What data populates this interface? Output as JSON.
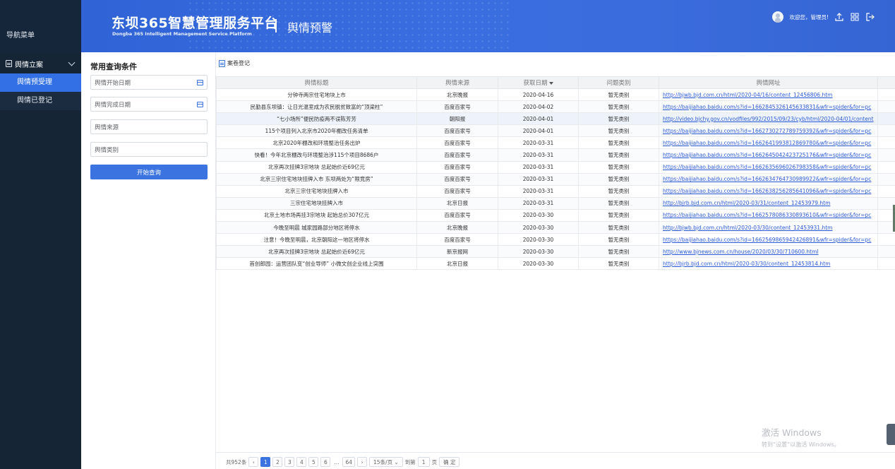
{
  "sidebar": {
    "nav_title": "导航菜单",
    "group_label": "舆情立案",
    "items": [
      {
        "label": "舆情预受理"
      },
      {
        "label": "舆情已登记"
      }
    ]
  },
  "header": {
    "brand_title": "东坝365智慧管理服务平台",
    "brand_subtitle": "Dongba 365 Intelligent Management Service Platform",
    "page_title": "舆情预警",
    "welcome": "欢迎您，管理员!"
  },
  "query": {
    "title": "常用查询条件",
    "start_date_placeholder": "舆情开始日期",
    "end_date_placeholder": "舆情完成日期",
    "source_placeholder": "舆情来源",
    "category_placeholder": "舆情类别",
    "search_button": "开始查询"
  },
  "toolbar": {
    "register_label": "案卷登记"
  },
  "table": {
    "columns": [
      "舆情标题",
      "舆情来源",
      "获取日期",
      "问题类别",
      "舆情网址"
    ],
    "rows": [
      [
        "分钟寺两宗住宅地块上市",
        "北京晚报",
        "2020-04-16",
        "暂无类别",
        "http://bjwb.bjd.com.cn/html/2020-04/16/content_12456806.htm"
      ],
      [
        "民勤县东坝镇：让日光温室成为农民脱贫致富的“顶梁柱”",
        "百度百家号",
        "2020-04-02",
        "暂无类别",
        "https://baijiahao.baidu.com/s?id=1662845326145633831&wfr=spider&for=pc"
      ],
      [
        "“七小场所”便民防疫两不误陈芳芳",
        "朝阳报",
        "2020-04-01",
        "暂无类别",
        "http://video.bjchy.gov.cn/vodfiles/992/2015/09/23/cyb/html/2020-04/01/content"
      ],
      [
        "115个项目列入北京市2020年棚改任务清单",
        "百度百家号",
        "2020-04-01",
        "暂无类别",
        "https://baijiahao.baidu.com/s?id=1662730272789759392&wfr=spider&for=pc"
      ],
      [
        "北京2020年棚改和环境整治任务出炉",
        "百度百家号",
        "2020-03-31",
        "暂无类别",
        "https://baijiahao.baidu.com/s?id=1662641993812869780&wfr=spider&for=pc"
      ],
      [
        "快看！今年北京棚改与环境整治涉115个项目8686户",
        "百度百家号",
        "2020-03-31",
        "暂无类别",
        "https://baijiahao.baidu.com/s?id=1662645042423725176&wfr=spider&for=pc"
      ],
      [
        "北京再次挂牌3宗地块 总起始价近69亿元",
        "百度百家号",
        "2020-03-31",
        "暂无类别",
        "https://baijiahao.baidu.com/s?id=1662635696026798358&wfr=spider&for=pc"
      ],
      [
        "北京三宗住宅地块挂牌入市 东坝两处为“限竞房”",
        "百度百家号",
        "2020-03-31",
        "暂无类别",
        "https://baijiahao.baidu.com/s?id=1662634764730989922&wfr=spider&for=pc"
      ],
      [
        "北京三宗住宅地块挂牌入市",
        "百度百家号",
        "2020-03-31",
        "暂无类别",
        "https://baijiahao.baidu.com/s?id=1662638256285641096&wfr=spider&for=pc"
      ],
      [
        "三宗住宅地块挂牌入市",
        "北京日报",
        "2020-03-31",
        "暂无类别",
        "http://bjrb.bjd.com.cn/html/2020-03/31/content_12453979.htm"
      ],
      [
        "北京土地市场再挂3宗地块 起始总价307亿元",
        "百度百家号",
        "2020-03-30",
        "暂无类别",
        "https://baijiahao.baidu.com/s?id=1662578086330893610&wfr=spider&for=pc"
      ],
      [
        "今晚至明晨 城家园路部分地区将停水",
        "北京晚报",
        "2020-03-30",
        "暂无类别",
        "http://bjwb.bjd.com.cn/html/2020-03/30/content_12453931.htm"
      ],
      [
        "注意！今晚至明晨，北京朝阳这一地区将停水",
        "百度百家号",
        "2020-03-30",
        "暂无类别",
        "https://baijiahao.baidu.com/s?id=1662569865942426891&wfr=spider&for=pc"
      ],
      [
        "北京再次挂牌3宗地块 总起始价近69亿元",
        "新京报网",
        "2020-03-30",
        "暂无类别",
        "http://www.bjnews.com.cn/house/2020/03/30/710600.html"
      ],
      [
        "首创郎园：运营团队变“创业导师” 小微文创企业线上突围",
        "北京日报",
        "2020-03-30",
        "暂无类别",
        "http://bjrb.bjd.com.cn/html/2020-03/30/content_12453814.htm"
      ]
    ]
  },
  "pager": {
    "total": "共952条",
    "pages": [
      "1",
      "2",
      "3",
      "4",
      "5",
      "6"
    ],
    "ellipsis": "...",
    "last_page": "64",
    "page_size": "15条/页",
    "goto_label": "到第",
    "goto_value": "1",
    "page_unit": "页",
    "confirm": "确 定"
  },
  "watermark": {
    "line1": "激活 Windows",
    "line2": "转到“设置”以激活 Windows。"
  }
}
